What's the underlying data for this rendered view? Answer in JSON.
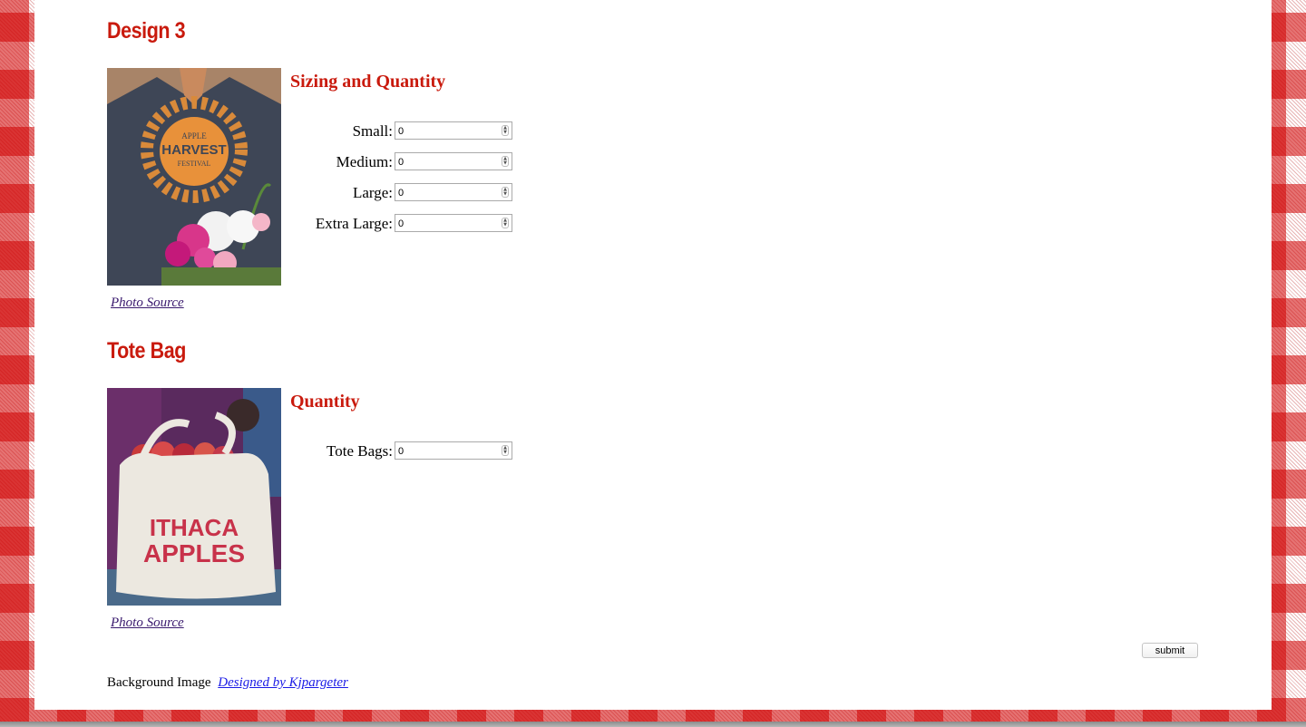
{
  "sections": [
    {
      "title": "Design 3",
      "photo_link": "Photo Source",
      "subtitle": "Sizing and Quantity",
      "fields": [
        {
          "label": "Small:",
          "value": "0"
        },
        {
          "label": "Medium:",
          "value": "0"
        },
        {
          "label": "Large:",
          "value": "0"
        },
        {
          "label": "Extra Large:",
          "value": "0"
        }
      ],
      "photo_text": {
        "line1": "APPLE",
        "line2": "HARVEST",
        "line3": "FESTIVAL"
      }
    },
    {
      "title": "Tote Bag",
      "photo_link": "Photo Source",
      "subtitle": "Quantity",
      "fields": [
        {
          "label": "Tote Bags:",
          "value": "0"
        }
      ],
      "photo_text": {
        "line1": "ITHACA",
        "line2": "APPLES"
      }
    }
  ],
  "submit_label": "submit",
  "footer": {
    "text": "Background Image",
    "link": "Designed by Kjpargeter"
  },
  "colors": {
    "accent": "#c91a0d",
    "link_visited": "#3a1a6e",
    "link": "#1a1ae6",
    "gingham": "#d00000"
  },
  "icons": {
    "spinner": "number-spinner-icon"
  }
}
